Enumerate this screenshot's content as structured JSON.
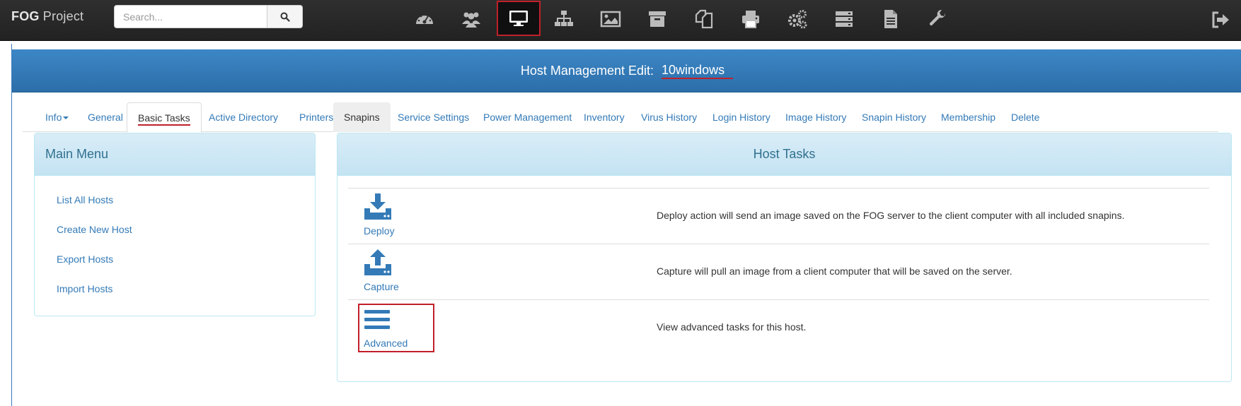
{
  "brand": {
    "strong": "FOG",
    "rest": " Project"
  },
  "search": {
    "placeholder": "Search..."
  },
  "nav": {
    "icons": [
      {
        "name": "dashboard-icon"
      },
      {
        "name": "users-icon"
      },
      {
        "name": "host-management-icon",
        "active": true
      },
      {
        "name": "group-icon"
      },
      {
        "name": "image-icon"
      },
      {
        "name": "storage-icon"
      },
      {
        "name": "snapin-icon"
      },
      {
        "name": "printer-icon"
      },
      {
        "name": "service-icon"
      },
      {
        "name": "tasks-icon"
      },
      {
        "name": "report-icon"
      },
      {
        "name": "settings-icon"
      }
    ],
    "logout_icon": "logout-icon"
  },
  "header": {
    "prefix": "Host Management Edit: ",
    "hostname": "10windows"
  },
  "tabs": [
    {
      "label": "Info"
    },
    {
      "label": "General"
    },
    {
      "label": "Basic Tasks"
    },
    {
      "label": "Active Directory"
    },
    {
      "label": "Printers"
    },
    {
      "label": "Snapins"
    },
    {
      "label": "Service Settings"
    },
    {
      "label": "Power Management"
    },
    {
      "label": "Inventory"
    },
    {
      "label": "Virus History"
    },
    {
      "label": "Login History"
    },
    {
      "label": "Image History"
    },
    {
      "label": "Snapin History"
    },
    {
      "label": "Membership"
    },
    {
      "label": "Delete"
    }
  ],
  "main_menu": {
    "title": "Main Menu",
    "items": [
      {
        "label": "List All Hosts"
      },
      {
        "label": "Create New Host"
      },
      {
        "label": "Export Hosts"
      },
      {
        "label": "Import Hosts"
      }
    ]
  },
  "host_tasks": {
    "title": "Host Tasks",
    "rows": [
      {
        "label": "Deploy",
        "icon": "deploy-icon",
        "description": "Deploy action will send an image saved on the FOG server to the client computer with all included snapins."
      },
      {
        "label": "Capture",
        "icon": "capture-icon",
        "description": "Capture will pull an image from a client computer that will be saved on the server."
      },
      {
        "label": "Advanced",
        "icon": "advanced-icon",
        "description": "View advanced tasks for this host."
      }
    ]
  },
  "colors": {
    "accent": "#337ab7",
    "highlight": "#c0202a",
    "header": "#2c6ea9"
  }
}
